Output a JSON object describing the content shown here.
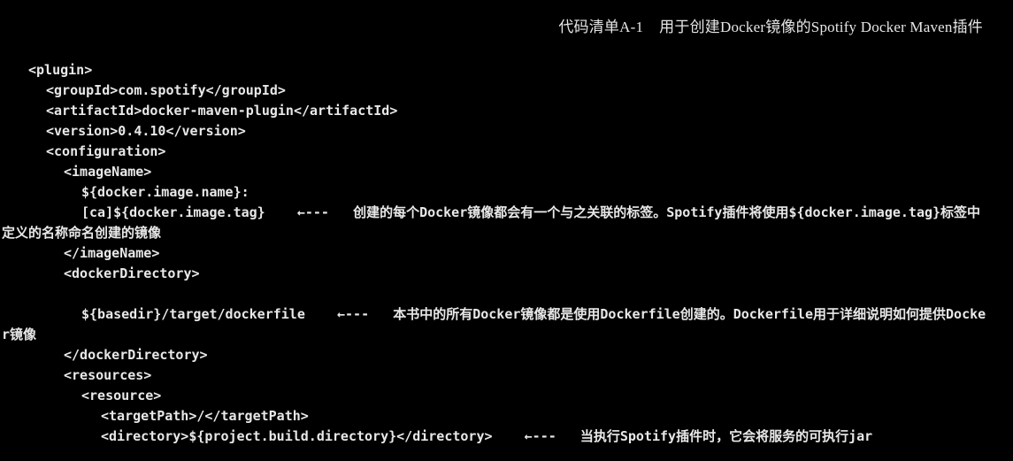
{
  "caption": {
    "label": "代码清单A-1",
    "title": "用于创建Docker镜像的Spotify Docker Maven插件"
  },
  "code": {
    "lines": {
      "l1": "<plugin>",
      "l2": "<groupId>com.spotify</groupId>",
      "l3": "<artifactId>docker-maven-plugin</artifactId>",
      "l4": "<version>0.4.10</version>",
      "l5": "<configuration>",
      "l6": "<imageName>",
      "l7": "${docker.image.name}:",
      "l8_code": "[ca]${docker.image.tag}",
      "l10": "</imageName>",
      "l11": "<dockerDirectory>",
      "l13_code": "${basedir}/target/dockerfile",
      "l15": "</dockerDirectory>",
      "l16": "<resources>",
      "l17": "<resource>",
      "l18": "<targetPath>/</targetPath>",
      "l19_code": "<directory>${project.build.directory}</directory>"
    },
    "arrow": "←---",
    "annotations": {
      "a1": "创建的每个Docker镜像都会有一个与之关联的标签。Spotify插件将使用${docker.image.tag}标签中定义的名称命名创建的镜像",
      "a2": "本书中的所有Docker镜像都是使用Dockerfile创建的。Dockerfile用于详细说明如何提供Docker镜像",
      "a3": "当执行Spotify插件时，它会将服务的可执行jar"
    }
  }
}
